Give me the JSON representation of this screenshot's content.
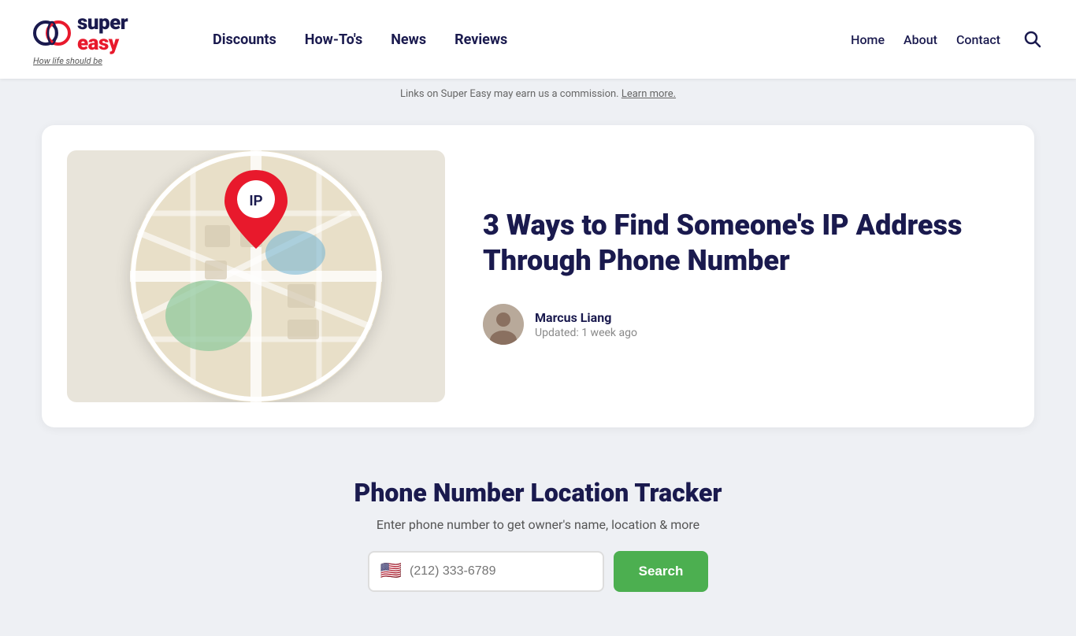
{
  "header": {
    "logo": {
      "super_text": "super",
      "easy_text": "easy",
      "tagline_prefix": "How life ",
      "tagline_em": "should",
      "tagline_suffix": " be"
    },
    "nav": {
      "items": [
        {
          "label": "Discounts",
          "id": "discounts"
        },
        {
          "label": "How-To's",
          "id": "howtos"
        },
        {
          "label": "News",
          "id": "news"
        },
        {
          "label": "Reviews",
          "id": "reviews"
        }
      ]
    },
    "right_nav": {
      "items": [
        {
          "label": "Home",
          "id": "home"
        },
        {
          "label": "About",
          "id": "about"
        },
        {
          "label": "Contact",
          "id": "contact"
        }
      ]
    }
  },
  "announcement": {
    "text": "Links on Super Easy may earn us a commission.",
    "link_text": "Learn more."
  },
  "article": {
    "title": "3 Ways to Find Someone's IP Address Through Phone Number",
    "author": {
      "name": "Marcus Liang",
      "updated": "Updated: 1 week ago"
    }
  },
  "tracker_widget": {
    "title": "Phone Number Location Tracker",
    "subtitle": "Enter phone number to get owner's name, location & more",
    "phone_placeholder": "(212) 333-6789",
    "search_btn_label": "Search",
    "flag": "🇺🇸"
  }
}
